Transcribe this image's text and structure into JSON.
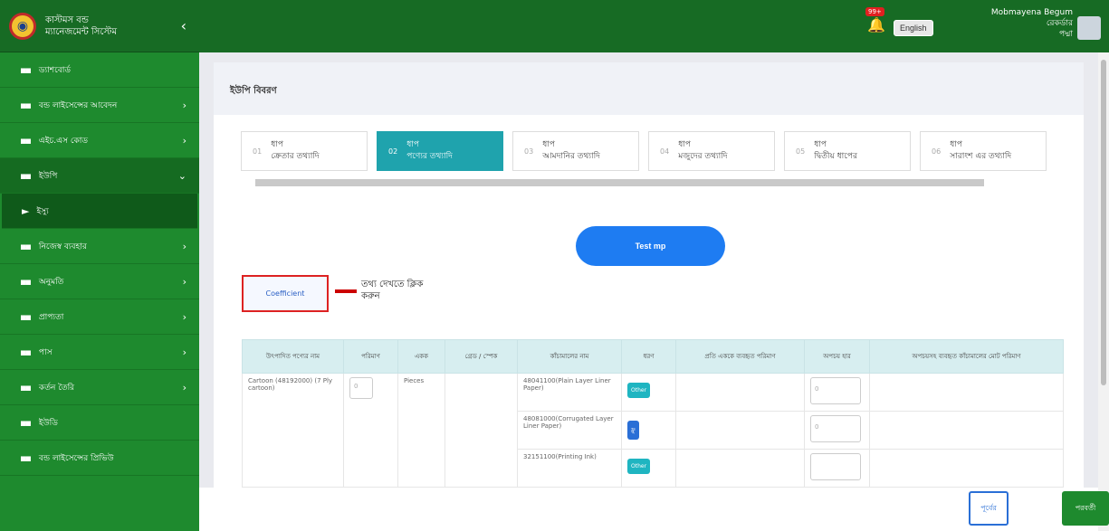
{
  "app": {
    "title_line1": "কাস্টমস বন্ড",
    "title_line2": "ম্যানেজমেন্ট সিস্টেম",
    "collapse_icon": "‹"
  },
  "sidebar": {
    "items": [
      {
        "label": "ড্যাশবোর্ড",
        "arrow": ""
      },
      {
        "label": "বন্ড লাইসেন্সের আবেদন",
        "arrow": "›"
      },
      {
        "label": "এইচ.এস কোড",
        "arrow": "›"
      },
      {
        "label": "ইউপি",
        "arrow": "⌄"
      },
      {
        "label": "ইস্যু",
        "arrow": ""
      },
      {
        "label": "নিজেস্ব ব্যবহার",
        "arrow": "›"
      },
      {
        "label": "অনুমতি",
        "arrow": "›"
      },
      {
        "label": "প্রাপ্যতা",
        "arrow": "›"
      },
      {
        "label": "পাস",
        "arrow": "›"
      },
      {
        "label": "কর্তন তৈরি",
        "arrow": "›"
      },
      {
        "label": "ইউডি",
        "arrow": ""
      },
      {
        "label": "বন্ড লাইসেন্সের প্রিভিউ",
        "arrow": ""
      }
    ]
  },
  "topbar": {
    "notif_badge": "99+",
    "language_button": "English",
    "user_name": "Mobmayena Begum",
    "user_role_1": "রেকর্ডার",
    "user_role_2": "পদ্মা"
  },
  "page": {
    "title": "ইউপি বিবরণ"
  },
  "steps": [
    {
      "top": "ধাপ",
      "label": "ক্রেতার তথ্যাদি"
    },
    {
      "top": "ধাপ",
      "label": "পণ্যের তথ্যাদি"
    },
    {
      "top": "ধাপ",
      "label": "আমদানির তথ্যাদি"
    },
    {
      "top": "ধাপ",
      "label": "মজুদের তথ্যাদি"
    },
    {
      "top": "ধাপ",
      "label": "দ্বিতীয় ধাপের"
    },
    {
      "top": "ধাপ",
      "label": "সারাংশ এর তথ্যাদি"
    }
  ],
  "buttons": {
    "test": "Test mp",
    "coefficient": "Coefficient",
    "previous": "পূর্বের",
    "next": "পরবর্তী"
  },
  "hint": {
    "text": "তথ্য দেখতে ক্লিক করুন"
  },
  "table": {
    "headers": [
      "উৎপাদিত পণ্যের নাম",
      "পরিমাণ",
      "একক",
      "গ্রেড / স্পেক",
      "কাঁচামালের নাম",
      "ধরণ",
      "প্রতি এককে ব্যবহৃত পরিমাণ",
      "অপচয় হার",
      "অপচয়সহ ব্যবহৃত কাঁচামালের মোট পরিমাণ"
    ],
    "product": "Cartoon (48192000) (7 Ply cartoon)",
    "qty_placeholder": "0",
    "unit": "Pieces",
    "rows": [
      {
        "material": "48041100(Plain Layer Liner Paper)",
        "type": "Other",
        "waste": "0"
      },
      {
        "material": "48081000(Corrugated Layer Liner Paper)",
        "type": "ফ্লু",
        "waste": "0"
      },
      {
        "material": "32151100(Printing Ink)",
        "type": "Other",
        "waste": ""
      }
    ]
  },
  "colors": {
    "sidebar": "#1e8a2e",
    "topbar": "#176b24",
    "step_active": "#1fa3ad",
    "primary_button": "#1e7cf2",
    "highlight_border": "#dd2222"
  }
}
